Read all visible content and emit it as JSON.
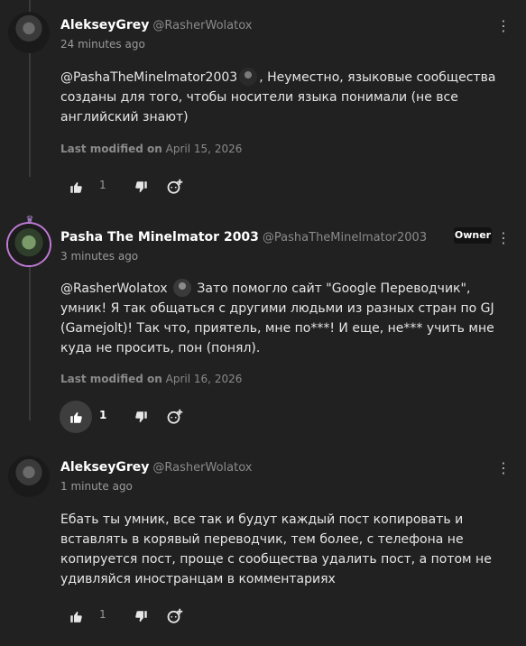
{
  "comments": [
    {
      "author": "AlekseyGrey",
      "handle": "@RasherWolatox",
      "time": "24 minutes ago",
      "mention": "@PashaTheMinelmator2003",
      "text": ", Неуместно, языковые сообщества созданы для того, чтобы носители языка понимали (не все английский знают)",
      "modified_label": "Last modified on",
      "modified_date": "April 15, 2026",
      "likes": "1"
    },
    {
      "author": "Pasha The Minelmator 2003",
      "handle": "@PashaTheMinelmator2003",
      "badge": "Owner",
      "time": "3 minutes ago",
      "mention": "@RasherWolatox",
      "text": " Зато помогло сайт \"Google Переводчик\", умник! Я так общаться с другими людьми из разных стран по GJ (Gamejolt)! Так что, приятель, мне по***! И еще, не*** учить мне куда не просить, пон (понял).",
      "modified_label": "Last modified on",
      "modified_date": "April 16, 2026",
      "likes": "1"
    },
    {
      "author": "AlekseyGrey",
      "handle": "@RasherWolatox",
      "time": "1 minute ago",
      "text": "Ебать ты умник, все так и будут каждый пост копировать и вставлять в корявый переводчик, тем более, с телефона не копируется пост, проще с сообщества удалить пост, а потом не удивляйся иностранцам в комментариях",
      "likes": "1"
    }
  ],
  "icons": {
    "more": "more-vertical-icon",
    "like": "thumbs-up-icon",
    "dislike": "thumbs-down-icon",
    "reply": "reply-icon"
  },
  "colors": {
    "background": "#212121",
    "owner_ring": "#c07ad6",
    "text": "#e6e6e6",
    "muted": "#8a8a8a"
  }
}
